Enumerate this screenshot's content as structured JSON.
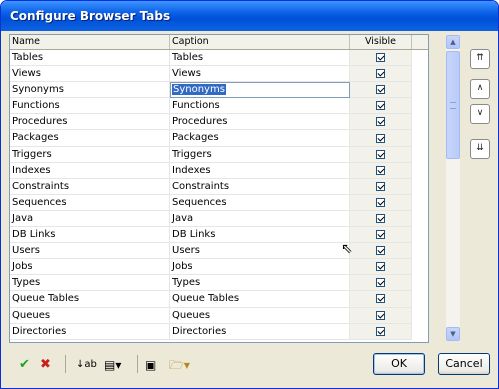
{
  "window": {
    "title": "Configure Browser Tabs"
  },
  "grid": {
    "columns": [
      "Name",
      "Caption",
      "Visible"
    ],
    "rows": [
      {
        "name": "Tables",
        "caption": "Tables"
      },
      {
        "name": "Views",
        "caption": "Views"
      },
      {
        "name": "Synonyms",
        "caption": "Synonyms"
      },
      {
        "name": "Functions",
        "caption": "Functions"
      },
      {
        "name": "Procedures",
        "caption": "Procedures"
      },
      {
        "name": "Packages",
        "caption": "Packages"
      },
      {
        "name": "Triggers",
        "caption": "Triggers"
      },
      {
        "name": "Indexes",
        "caption": "Indexes"
      },
      {
        "name": "Constraints",
        "caption": "Constraints"
      },
      {
        "name": "Sequences",
        "caption": "Sequences"
      },
      {
        "name": "Java",
        "caption": "Java"
      },
      {
        "name": "DB Links",
        "caption": "DB Links"
      },
      {
        "name": "Users",
        "caption": "Users"
      },
      {
        "name": "Jobs",
        "caption": "Jobs"
      },
      {
        "name": "Types",
        "caption": "Types"
      },
      {
        "name": "Queue Tables",
        "caption": "Queue Tables"
      },
      {
        "name": "Queues",
        "caption": "Queues"
      },
      {
        "name": "Directories",
        "caption": "Directories"
      }
    ],
    "selected_row": 2
  },
  "side_buttons": [
    "move-top-icon",
    "move-up-icon",
    "move-down-icon",
    "move-bottom-icon"
  ],
  "toolbar": [
    "accept-icon",
    "cancel-icon",
    "sort-icon",
    "copy-icon",
    "select-icon",
    "open-folder-icon"
  ],
  "buttons": {
    "ok": "OK",
    "cancel": "Cancel"
  }
}
